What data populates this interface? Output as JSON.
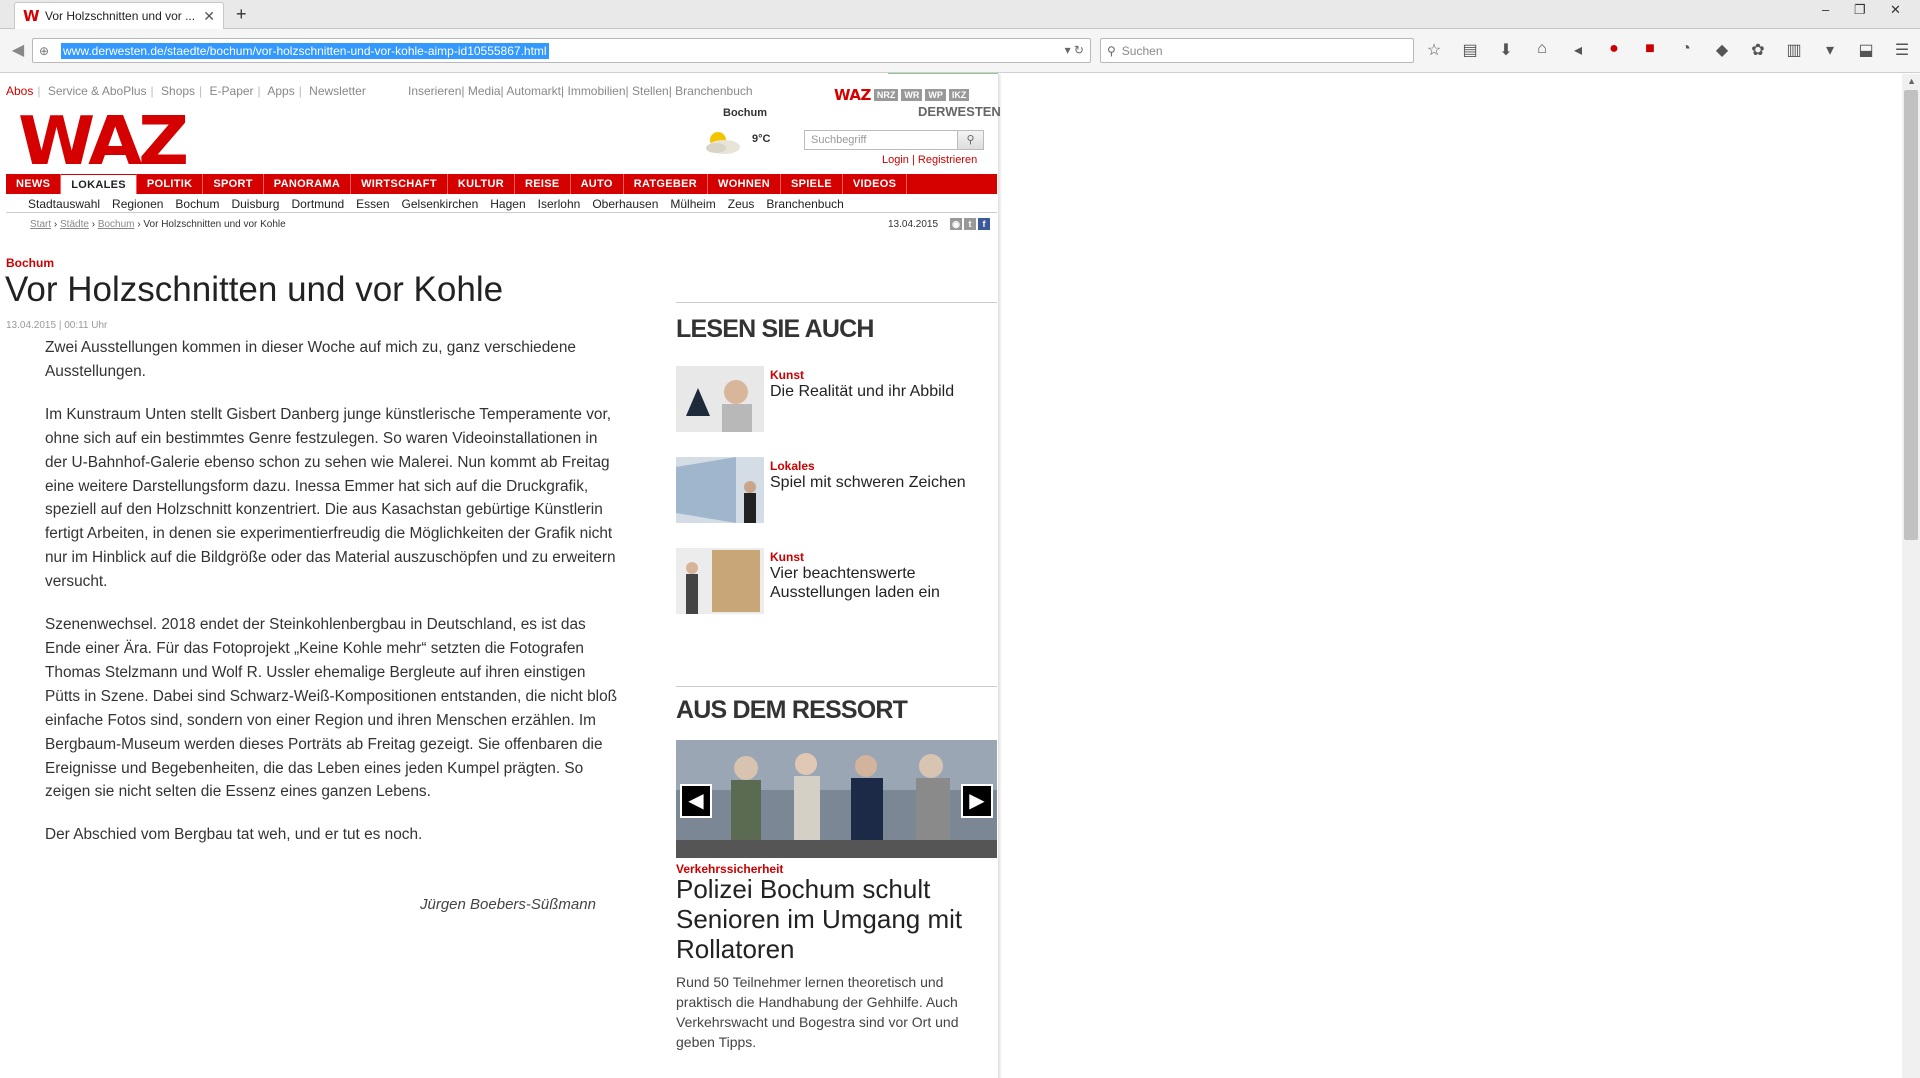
{
  "browser": {
    "tab_title": "Vor Holzschnitten und vor ...",
    "tab_favicon": "W",
    "new_tab": "+",
    "url": "www.derwesten.de/staedte/bochum/vor-holzschnitten-und-vor-kohle-aimp-id10555867.html",
    "search_placeholder": "Suchen",
    "window_controls": [
      "–",
      "❐",
      "✕"
    ]
  },
  "site": {
    "service_links": [
      "Abos",
      "Service & AboPlus",
      "Shops",
      "E-Paper",
      "Apps",
      "Newsletter"
    ],
    "service_links2": [
      "Inserieren",
      "Media",
      "Automarkt",
      "Immobilien",
      "Stellen",
      "Branchenbuch"
    ],
    "brands": [
      "WAZ",
      "NRZ",
      "WR",
      "WP",
      "IKZ"
    ],
    "portal": "DERWESTEN",
    "logo": "WAZ",
    "weather_city": "Bochum",
    "weather_temp": "9°C",
    "search_placeholder": "Suchbegriff",
    "login": "Login",
    "register": "Registrieren",
    "main_nav": [
      "NEWS",
      "LOKALES",
      "POLITIK",
      "SPORT",
      "PANORAMA",
      "WIRTSCHAFT",
      "KULTUR",
      "REISE",
      "AUTO",
      "RATGEBER",
      "WOHNEN",
      "SPIELE",
      "VIDEOS"
    ],
    "sub_nav": [
      "Stadtauswahl",
      "Regionen",
      "Bochum",
      "Duisburg",
      "Dortmund",
      "Essen",
      "Gelsenkirchen",
      "Hagen",
      "Iserlohn",
      "Oberhausen",
      "Mülheim",
      "Zeus",
      "Branchenbuch"
    ],
    "breadcrumbs": [
      "Start",
      "Städte",
      "Bochum",
      "Vor Holzschnitten und vor Kohle"
    ],
    "breadcrumb_date": "13.04.2015"
  },
  "article": {
    "kicker": "Bochum",
    "headline": "Vor Holzschnitten und vor Kohle",
    "meta": "13.04.2015 | 00:11 Uhr",
    "paragraphs": [
      "Zwei Ausstellungen kommen in dieser Woche auf mich zu, ganz verschiedene Ausstellungen.",
      "Im Kunstraum Unten stellt Gisbert Danberg junge künstlerische Temperamente vor, ohne sich auf ein bestimmtes Genre festzulegen. So waren Videoinstallationen in der U-Bahnhof-Galerie ebenso schon zu sehen wie Malerei. Nun kommt ab Freitag eine weitere Darstellungsform dazu. Inessa Emmer hat sich auf die Druckgrafik, speziell auf den Holzschnitt konzentriert. Die aus Kasachstan gebürtige Künstlerin fertigt Arbeiten, in denen sie experimentierfreudig die Möglichkeiten der Grafik nicht nur im Hinblick auf die Bildgröße oder das Material auszuschöpfen und zu erweitern versucht.",
      "Szenenwechsel. 2018 endet der Steinkohlenbergbau in Deutschland, es ist das Ende einer Ära. Für das Fotoprojekt „Keine Kohle mehr“ setzten die Fotografen Thomas Stelzmann und Wolf R. Ussler ehemalige Bergleute auf ihren einstigen Pütts in Szene. Dabei sind Schwarz-Weiß-Kompositionen entstanden, die nicht bloß einfache Fotos sind, sondern von einer Region und ihren Menschen erzählen. Im Bergbaum-Museum werden dieses Porträts ab Freitag gezeigt. Sie offenbaren die Ereignisse und Begebenheiten, die das Leben eines jeden Kumpel prägten. So zeigen sie nicht selten die Essenz eines ganzen Lebens.",
      "Der Abschied vom Bergbau tat weh, und er tut es noch."
    ],
    "author": "Jürgen Boebers-Süßmann"
  },
  "sidebar": {
    "lesen_title": "LESEN SIE AUCH",
    "teasers": [
      {
        "kicker": "Kunst",
        "title": "Die Realität und ihr Abbild"
      },
      {
        "kicker": "Lokales",
        "title": "Spiel mit schweren Zeichen"
      },
      {
        "kicker": "Kunst",
        "title": "Vier beachtenswerte Ausstellungen laden ein"
      }
    ],
    "ressort_title": "AUS DEM RESSORT",
    "hero": {
      "kicker": "Verkehrssicherheit",
      "title": "Polizei Bochum schult Senioren im Umgang mit Rollatoren",
      "desc": "Rund 50 Teilnehmer lernen theoretisch und praktisch die Handhabung der Gehhilfe. Auch Verkehrswacht und Bogestra sind vor Ort und geben Tipps."
    }
  },
  "colors": {
    "brand_red": "#d50000",
    "kicker_red": "#cc0000"
  }
}
